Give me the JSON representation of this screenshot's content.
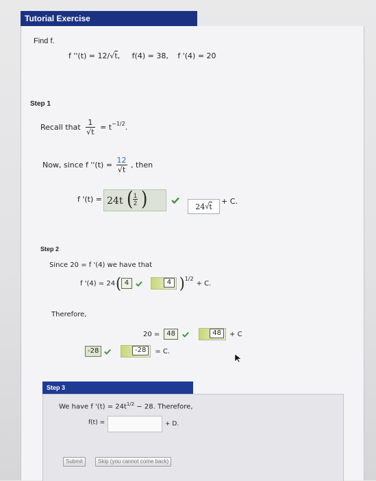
{
  "header": {
    "title": "Tutorial Exercise"
  },
  "intro": {
    "find": "Find f.",
    "given_fpp": "f ''(t) = 12/",
    "given_sqrt_t": "t",
    "given_comma": ",",
    "given_f4": "f(4) = 38,",
    "given_fp4": "f '(4) = 20"
  },
  "step1": {
    "label": "Step 1",
    "recall_prefix": "Recall that",
    "frac_num": "1",
    "frac_den": "t",
    "recall_result": "= t",
    "recall_exp": "−1/2",
    "recall_end": ".",
    "now_prefix": "Now, since  f ''(t) =",
    "now_num": "12",
    "now_den": "t",
    "now_suffix": ",  then",
    "fp_label": "f '(t) =",
    "shaded_coef": "24t",
    "shaded_exp_num": "1",
    "shaded_exp_den": "2",
    "answer_coef": "24",
    "answer_sqrt": "t",
    "plus_c": "+ C."
  },
  "step2": {
    "label": "Step 2",
    "since_text": "Since  20 = f '(4)  we have that",
    "eq_left": "f '(4) = 24",
    "input1": "4",
    "input2": "4",
    "exp": "1/2",
    "plus_c": "+ C.",
    "therefore": "Therefore,",
    "eq2_left": "20 =",
    "input3": "48",
    "input4": "48",
    "eq2_right": "+ C",
    "input5": "-28",
    "input6": "-28",
    "eq3_right": "= C."
  },
  "step3": {
    "label": "Step 3",
    "we_have": "We have  f '(t) =  24t",
    "we_have_exp": "1/2",
    "we_have_tail": "− 28.  Therefore,",
    "f_label": "f(t) =",
    "f_input_value": "",
    "plus_d": "+ D."
  },
  "buttons": {
    "submit": "Submit",
    "skip": "Skip (you cannot come back)"
  },
  "colors": {
    "title_bar": "#1b3283",
    "check": "#3f9a3a",
    "accent_blue": "#3a62c2"
  }
}
